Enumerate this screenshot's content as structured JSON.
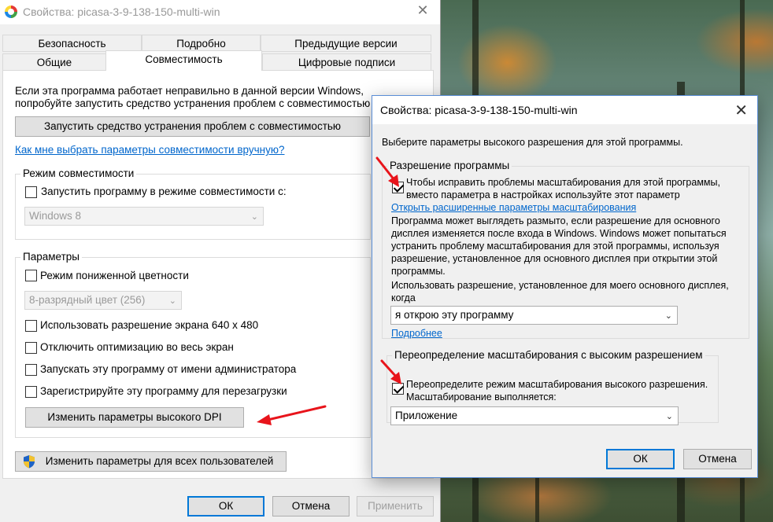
{
  "main_window": {
    "title": "Свойства: picasa-3-9-138-150-multi-win",
    "close": "✕",
    "tabs_row1": [
      "Безопасность",
      "Подробно",
      "Предыдущие версии"
    ],
    "tabs_row2": [
      "Общие",
      "Совместимость",
      "Цифровые подписи"
    ],
    "intro_line1": "Если эта программа работает неправильно в данной версии Windows,",
    "intro_line2": "попробуйте запустить средство устранения проблем с совместимостью.",
    "run_troubleshooter": "Запустить средство устранения проблем с совместимостью",
    "manual_link": "Как мне выбрать параметры совместимости вручную?",
    "compat_group": {
      "label": "Режим совместимости",
      "checkbox": "Запустить программу в режиме совместимости с:",
      "select_value": "Windows 8"
    },
    "params_group": {
      "label": "Параметры",
      "reduced_color": "Режим пониженной цветности",
      "color_select": "8-разрядный цвет (256)",
      "res_640": "Использовать разрешение экрана 640 x 480",
      "disable_fullscreen": "Отключить оптимизацию во весь экран",
      "run_admin": "Запускать эту программу от имени администратора",
      "register_restart": "Зарегистрируйте эту программу для перезагрузки",
      "high_dpi_button": "Изменить параметры высокого DPI"
    },
    "all_users_button": "Изменить параметры для всех пользователей",
    "ok": "ОК",
    "cancel": "Отмена",
    "apply": "Применить"
  },
  "dpi_dialog": {
    "title": "Свойства: picasa-3-9-138-150-multi-win",
    "close": "✕",
    "instruction": "Выберите параметры высокого разрешения для этой программы.",
    "program_dpi_group": {
      "label": "Разрешение программы",
      "checkbox_line1": "Чтобы исправить проблемы масштабирования для этой программы,",
      "checkbox_line2": "вместо параметра в настройках используйте этот параметр",
      "advanced_link": "Открыть расширенные параметры масштабирования",
      "description": "Программа может выглядеть размыто, если разрешение для основного дисплея изменяется после входа в Windows. Windows может попытаться устранить проблему масштабирования для этой программы, используя разрешение, установленное для основного дисплея при открытии этой программы.",
      "use_resolution": "Использовать разрешение, установленное для моего основного дисплея, когда",
      "select_value": "я открою эту программу",
      "more_link": "Подробнее"
    },
    "override_group": {
      "label": "Переопределение масштабирования с высоким разрешением",
      "checkbox_line1": "Переопределите режим масштабирования высокого разрешения.",
      "checkbox_line2": "Масштабирование выполняется:",
      "select_value": "Приложение"
    },
    "ok": "ОК",
    "cancel": "Отмена"
  },
  "colors": {
    "accent": "#0078d7",
    "link": "#0066cc",
    "annotation_arrow": "#e8141b"
  }
}
